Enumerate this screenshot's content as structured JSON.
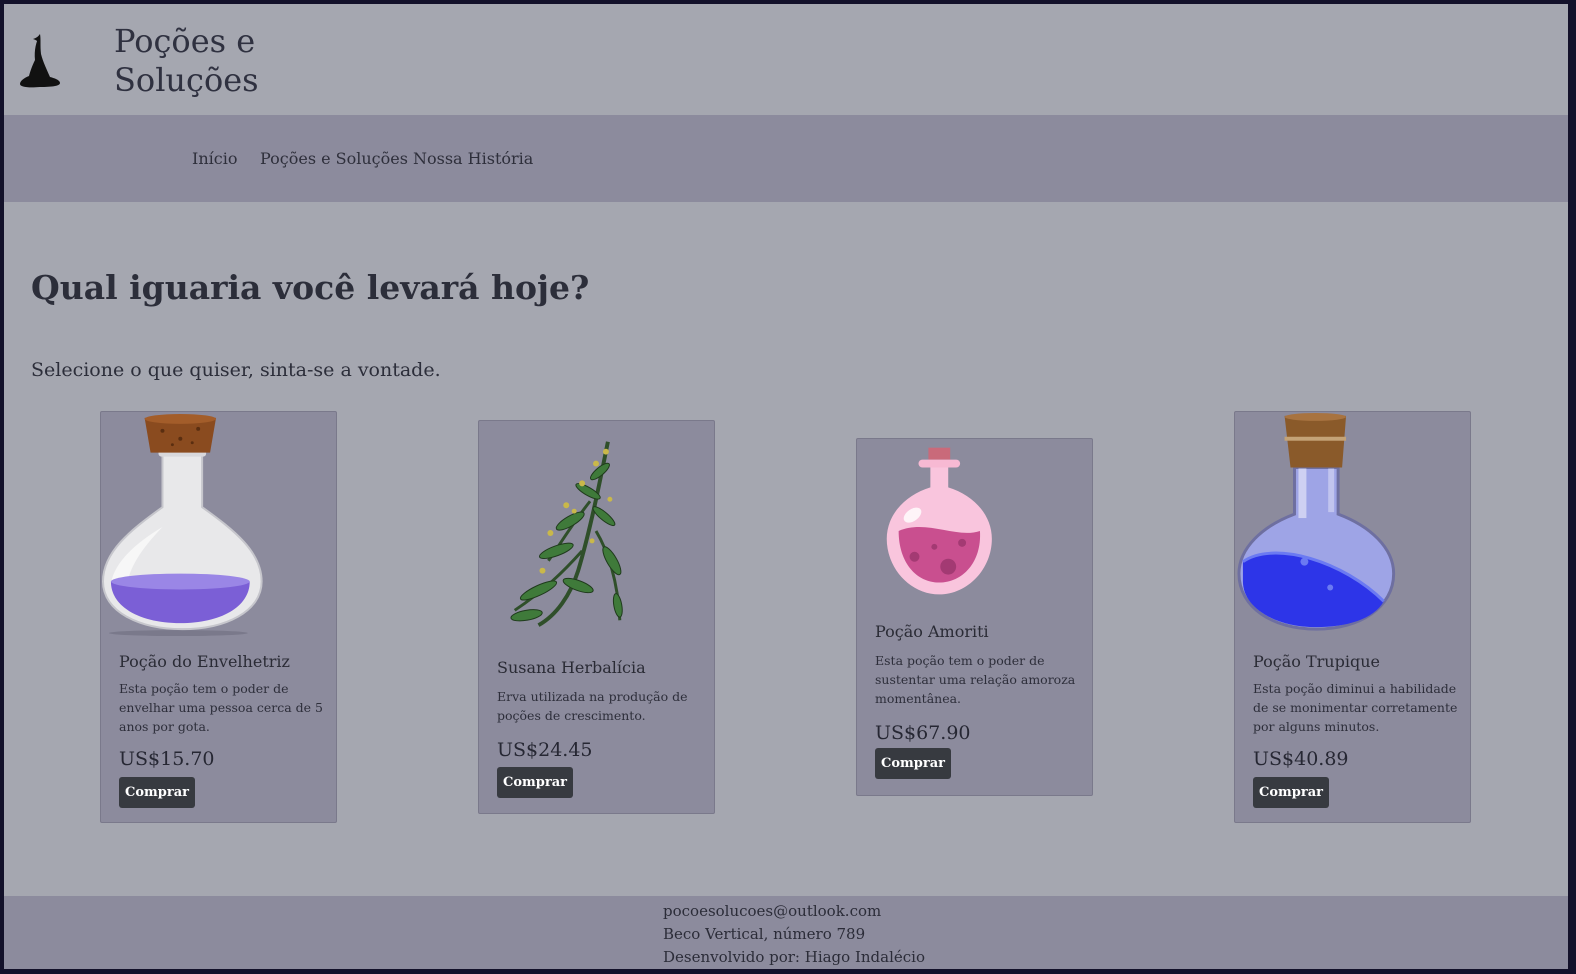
{
  "header": {
    "brand": "Poções e\nSoluções",
    "logo_icon": "witch-hat-icon"
  },
  "nav": {
    "items": [
      {
        "label": "Início"
      },
      {
        "label": "Poções e Soluções"
      },
      {
        "label": "Nossa História"
      }
    ]
  },
  "main": {
    "headline": "Qual iguaria você levará hoje?",
    "subhead": "Selecione o que quiser, sinta-se a vontade."
  },
  "products": [
    {
      "name": "Poção do Envelhetriz",
      "description": "Esta poção tem o poder de envelhar uma pessoa cerca de 5 anos por gota.",
      "price": "US$15.70",
      "button": "Comprar",
      "image": "purple-potion-flask-icon",
      "liquid_color": "#7b5fd6"
    },
    {
      "name": "Susana Herbalícia",
      "description": "Erva utilizada na produção de poções de crescimento.",
      "price": "US$24.45",
      "button": "Comprar",
      "image": "herb-plant-icon",
      "liquid_color": "#3f7a3a"
    },
    {
      "name": "Poção Amoriti",
      "description": "Esta poção tem o poder de sustentar uma relação amoroza momentânea.",
      "price": "US$67.90",
      "button": "Comprar",
      "image": "pink-potion-bottle-icon",
      "liquid_color": "#c94f8f"
    },
    {
      "name": "Poção Trupique",
      "description": "Esta poção diminui a habilidade de se monimentar corretamente por alguns minutos.",
      "price": "US$40.89",
      "button": "Comprar",
      "image": "blue-potion-flask-icon",
      "liquid_color": "#2d35e8"
    }
  ],
  "footer": {
    "email": "pocoesolucoes@outlook.com",
    "address": "Beco Vertical, número 789",
    "credit": "Desenvolvido por: Hiago Indalécio"
  }
}
